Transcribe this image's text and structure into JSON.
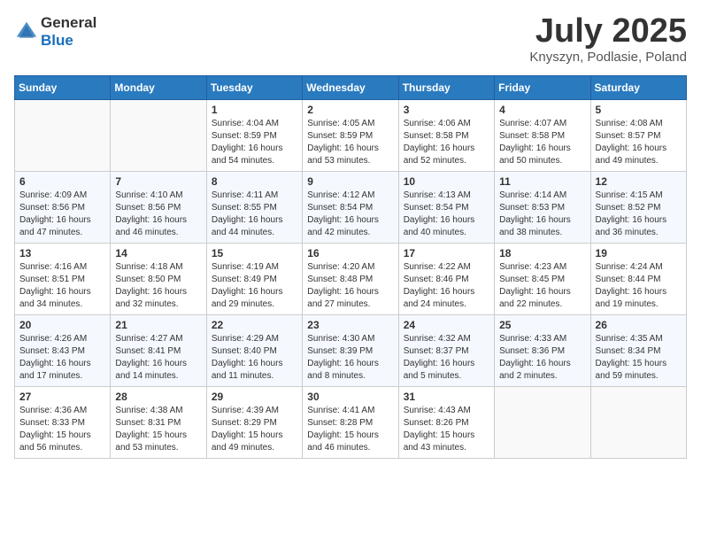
{
  "header": {
    "logo_general": "General",
    "logo_blue": "Blue",
    "month": "July 2025",
    "location": "Knyszyn, Podlasie, Poland"
  },
  "calendar": {
    "days_of_week": [
      "Sunday",
      "Monday",
      "Tuesday",
      "Wednesday",
      "Thursday",
      "Friday",
      "Saturday"
    ],
    "weeks": [
      [
        {
          "day": "",
          "sunrise": "",
          "sunset": "",
          "daylight": ""
        },
        {
          "day": "",
          "sunrise": "",
          "sunset": "",
          "daylight": ""
        },
        {
          "day": "1",
          "sunrise": "Sunrise: 4:04 AM",
          "sunset": "Sunset: 8:59 PM",
          "daylight": "Daylight: 16 hours and 54 minutes."
        },
        {
          "day": "2",
          "sunrise": "Sunrise: 4:05 AM",
          "sunset": "Sunset: 8:59 PM",
          "daylight": "Daylight: 16 hours and 53 minutes."
        },
        {
          "day": "3",
          "sunrise": "Sunrise: 4:06 AM",
          "sunset": "Sunset: 8:58 PM",
          "daylight": "Daylight: 16 hours and 52 minutes."
        },
        {
          "day": "4",
          "sunrise": "Sunrise: 4:07 AM",
          "sunset": "Sunset: 8:58 PM",
          "daylight": "Daylight: 16 hours and 50 minutes."
        },
        {
          "day": "5",
          "sunrise": "Sunrise: 4:08 AM",
          "sunset": "Sunset: 8:57 PM",
          "daylight": "Daylight: 16 hours and 49 minutes."
        }
      ],
      [
        {
          "day": "6",
          "sunrise": "Sunrise: 4:09 AM",
          "sunset": "Sunset: 8:56 PM",
          "daylight": "Daylight: 16 hours and 47 minutes."
        },
        {
          "day": "7",
          "sunrise": "Sunrise: 4:10 AM",
          "sunset": "Sunset: 8:56 PM",
          "daylight": "Daylight: 16 hours and 46 minutes."
        },
        {
          "day": "8",
          "sunrise": "Sunrise: 4:11 AM",
          "sunset": "Sunset: 8:55 PM",
          "daylight": "Daylight: 16 hours and 44 minutes."
        },
        {
          "day": "9",
          "sunrise": "Sunrise: 4:12 AM",
          "sunset": "Sunset: 8:54 PM",
          "daylight": "Daylight: 16 hours and 42 minutes."
        },
        {
          "day": "10",
          "sunrise": "Sunrise: 4:13 AM",
          "sunset": "Sunset: 8:54 PM",
          "daylight": "Daylight: 16 hours and 40 minutes."
        },
        {
          "day": "11",
          "sunrise": "Sunrise: 4:14 AM",
          "sunset": "Sunset: 8:53 PM",
          "daylight": "Daylight: 16 hours and 38 minutes."
        },
        {
          "day": "12",
          "sunrise": "Sunrise: 4:15 AM",
          "sunset": "Sunset: 8:52 PM",
          "daylight": "Daylight: 16 hours and 36 minutes."
        }
      ],
      [
        {
          "day": "13",
          "sunrise": "Sunrise: 4:16 AM",
          "sunset": "Sunset: 8:51 PM",
          "daylight": "Daylight: 16 hours and 34 minutes."
        },
        {
          "day": "14",
          "sunrise": "Sunrise: 4:18 AM",
          "sunset": "Sunset: 8:50 PM",
          "daylight": "Daylight: 16 hours and 32 minutes."
        },
        {
          "day": "15",
          "sunrise": "Sunrise: 4:19 AM",
          "sunset": "Sunset: 8:49 PM",
          "daylight": "Daylight: 16 hours and 29 minutes."
        },
        {
          "day": "16",
          "sunrise": "Sunrise: 4:20 AM",
          "sunset": "Sunset: 8:48 PM",
          "daylight": "Daylight: 16 hours and 27 minutes."
        },
        {
          "day": "17",
          "sunrise": "Sunrise: 4:22 AM",
          "sunset": "Sunset: 8:46 PM",
          "daylight": "Daylight: 16 hours and 24 minutes."
        },
        {
          "day": "18",
          "sunrise": "Sunrise: 4:23 AM",
          "sunset": "Sunset: 8:45 PM",
          "daylight": "Daylight: 16 hours and 22 minutes."
        },
        {
          "day": "19",
          "sunrise": "Sunrise: 4:24 AM",
          "sunset": "Sunset: 8:44 PM",
          "daylight": "Daylight: 16 hours and 19 minutes."
        }
      ],
      [
        {
          "day": "20",
          "sunrise": "Sunrise: 4:26 AM",
          "sunset": "Sunset: 8:43 PM",
          "daylight": "Daylight: 16 hours and 17 minutes."
        },
        {
          "day": "21",
          "sunrise": "Sunrise: 4:27 AM",
          "sunset": "Sunset: 8:41 PM",
          "daylight": "Daylight: 16 hours and 14 minutes."
        },
        {
          "day": "22",
          "sunrise": "Sunrise: 4:29 AM",
          "sunset": "Sunset: 8:40 PM",
          "daylight": "Daylight: 16 hours and 11 minutes."
        },
        {
          "day": "23",
          "sunrise": "Sunrise: 4:30 AM",
          "sunset": "Sunset: 8:39 PM",
          "daylight": "Daylight: 16 hours and 8 minutes."
        },
        {
          "day": "24",
          "sunrise": "Sunrise: 4:32 AM",
          "sunset": "Sunset: 8:37 PM",
          "daylight": "Daylight: 16 hours and 5 minutes."
        },
        {
          "day": "25",
          "sunrise": "Sunrise: 4:33 AM",
          "sunset": "Sunset: 8:36 PM",
          "daylight": "Daylight: 16 hours and 2 minutes."
        },
        {
          "day": "26",
          "sunrise": "Sunrise: 4:35 AM",
          "sunset": "Sunset: 8:34 PM",
          "daylight": "Daylight: 15 hours and 59 minutes."
        }
      ],
      [
        {
          "day": "27",
          "sunrise": "Sunrise: 4:36 AM",
          "sunset": "Sunset: 8:33 PM",
          "daylight": "Daylight: 15 hours and 56 minutes."
        },
        {
          "day": "28",
          "sunrise": "Sunrise: 4:38 AM",
          "sunset": "Sunset: 8:31 PM",
          "daylight": "Daylight: 15 hours and 53 minutes."
        },
        {
          "day": "29",
          "sunrise": "Sunrise: 4:39 AM",
          "sunset": "Sunset: 8:29 PM",
          "daylight": "Daylight: 15 hours and 49 minutes."
        },
        {
          "day": "30",
          "sunrise": "Sunrise: 4:41 AM",
          "sunset": "Sunset: 8:28 PM",
          "daylight": "Daylight: 15 hours and 46 minutes."
        },
        {
          "day": "31",
          "sunrise": "Sunrise: 4:43 AM",
          "sunset": "Sunset: 8:26 PM",
          "daylight": "Daylight: 15 hours and 43 minutes."
        },
        {
          "day": "",
          "sunrise": "",
          "sunset": "",
          "daylight": ""
        },
        {
          "day": "",
          "sunrise": "",
          "sunset": "",
          "daylight": ""
        }
      ]
    ]
  }
}
